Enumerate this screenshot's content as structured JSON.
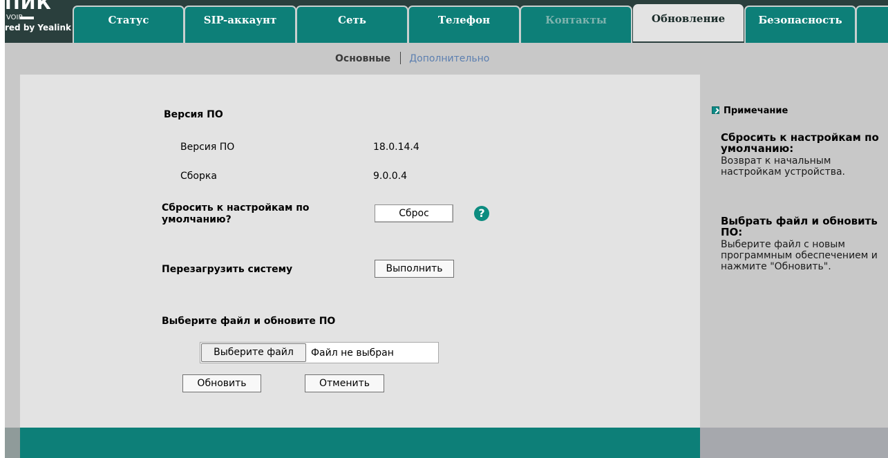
{
  "header": {
    "logo_mark": "ПИК",
    "logo_voip": "VOIP",
    "logo_powered": "red by Yealink",
    "tabs": [
      {
        "label": "Статус",
        "state": "normal"
      },
      {
        "label": "SIP-аккаунт",
        "state": "normal"
      },
      {
        "label": "Сеть",
        "state": "normal"
      },
      {
        "label": "Телефон",
        "state": "normal"
      },
      {
        "label": "Контакты",
        "state": "disabled"
      },
      {
        "label": "Обновление",
        "state": "active"
      },
      {
        "label": "Безопасность",
        "state": "normal"
      }
    ]
  },
  "subnav": {
    "basic": "Основные",
    "advanced": "Дополнительно"
  },
  "firmware": {
    "section_title": "Версия ПО",
    "version_label": "Версия ПО",
    "version_value": "18.0.14.4",
    "build_label": "Сборка",
    "build_value": "9.0.0.4"
  },
  "reset": {
    "label_line1": "Сбросить к настройкам по",
    "label_line2": "умолчанию?",
    "button": "Сброс",
    "help": "?"
  },
  "reboot": {
    "label": "Перезагрузить систему",
    "button": "Выполнить"
  },
  "upgrade": {
    "section_title": "Выберите файл и обновите ПО",
    "choose_button": "Выберите файл",
    "file_status": "Файл не выбран",
    "update_button": "Обновить",
    "cancel_button": "Отменить"
  },
  "note": {
    "title": "Примечание",
    "reset_heading": "Сбросить к настройкам по умолчанию:",
    "reset_text": "Возврат к начальным настройкам устройства.",
    "upgrade_heading": "Выбрать файл и обновить ПО:",
    "upgrade_text": "Выберите файл с новым программным обеспечением и нажмите \"Обновить\"."
  },
  "colors": {
    "teal": "#0d7f78",
    "header_dark": "#2a3f3d",
    "panel_gray": "#c8c8c8",
    "content_gray": "#e3e3e3",
    "help_icon": "#0d8c80"
  }
}
